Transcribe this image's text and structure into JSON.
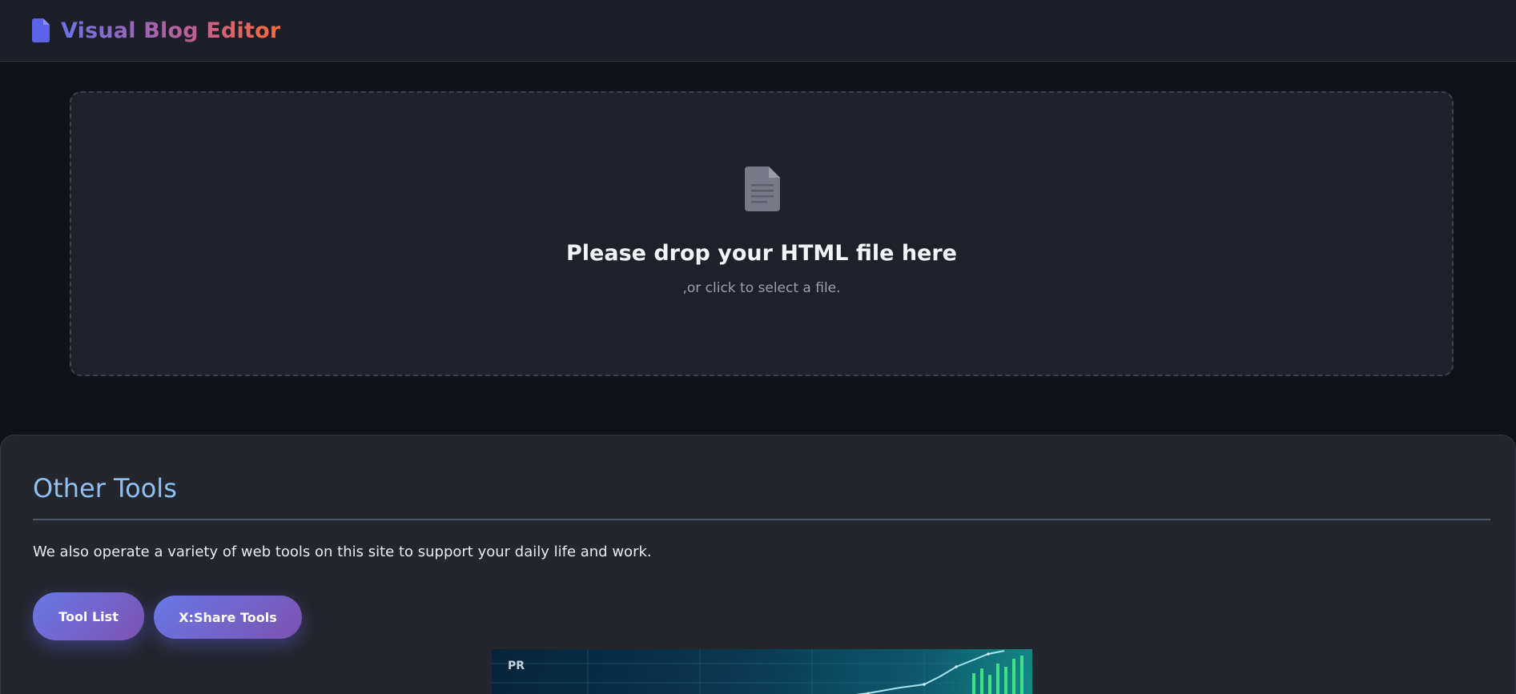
{
  "header": {
    "app_title": "Visual Blog Editor",
    "logo_icon": "document-icon",
    "title_gradient": [
      "#6b73e8",
      "#b45f9c",
      "#ff6a3d"
    ]
  },
  "dropzone": {
    "icon": "document-icon",
    "title": "Please drop your HTML file here",
    "subtitle": ",or click to select a file."
  },
  "other_tools": {
    "heading": "Other Tools",
    "description": "We also operate a variety of web tools on this site to support your daily life and work.",
    "buttons": [
      {
        "label": "Tool List"
      },
      {
        "label": "X:Share Tools"
      }
    ]
  },
  "promo": {
    "badge": "PR"
  },
  "colors": {
    "background": "#0f1216",
    "header_bg": "#1c1f27",
    "dropzone_bg": "#1e212a",
    "panel_bg": "#23262d",
    "heading": "#8fc0f2",
    "button_gradient": [
      "#6878e8",
      "#7d52b0"
    ]
  }
}
